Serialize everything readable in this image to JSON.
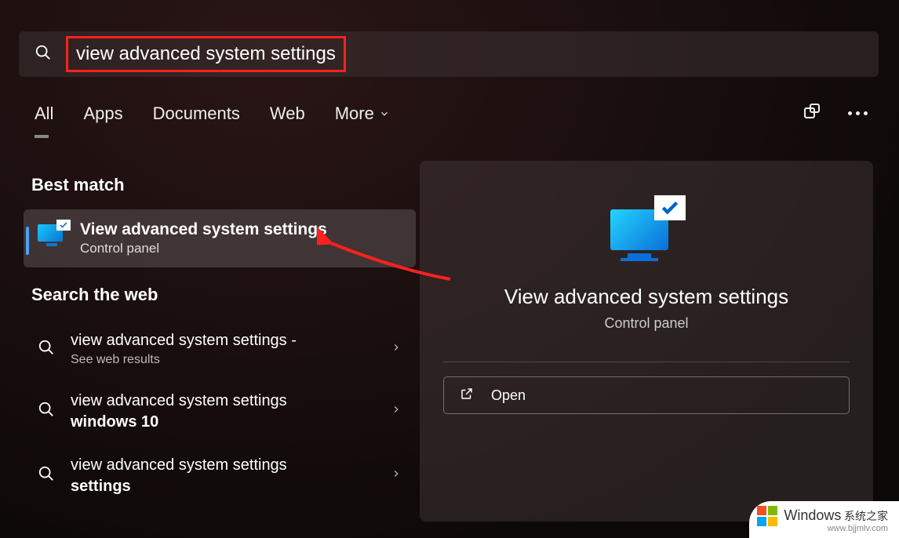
{
  "search": {
    "query": "view advanced system settings"
  },
  "tabs": {
    "all": "All",
    "apps": "Apps",
    "documents": "Documents",
    "web": "Web",
    "more": "More"
  },
  "sections": {
    "best_match": "Best match",
    "search_web": "Search the web"
  },
  "best_match": {
    "title": "View advanced system settings",
    "subtitle": "Control panel"
  },
  "web_results": [
    {
      "line1": "view advanced system settings",
      "suffix": " - ",
      "bold": "",
      "sub": "See web results"
    },
    {
      "line1": "view advanced system settings ",
      "suffix": "",
      "bold": "windows 10",
      "sub": ""
    },
    {
      "line1": "view advanced system settings ",
      "suffix": "",
      "bold": "settings",
      "sub": ""
    }
  ],
  "detail": {
    "title": "View advanced system settings",
    "subtitle": "Control panel",
    "open_label": "Open"
  },
  "watermark": {
    "brand": "Windows",
    "cn": "系统之家",
    "url": "www.bjjmlv.com"
  }
}
